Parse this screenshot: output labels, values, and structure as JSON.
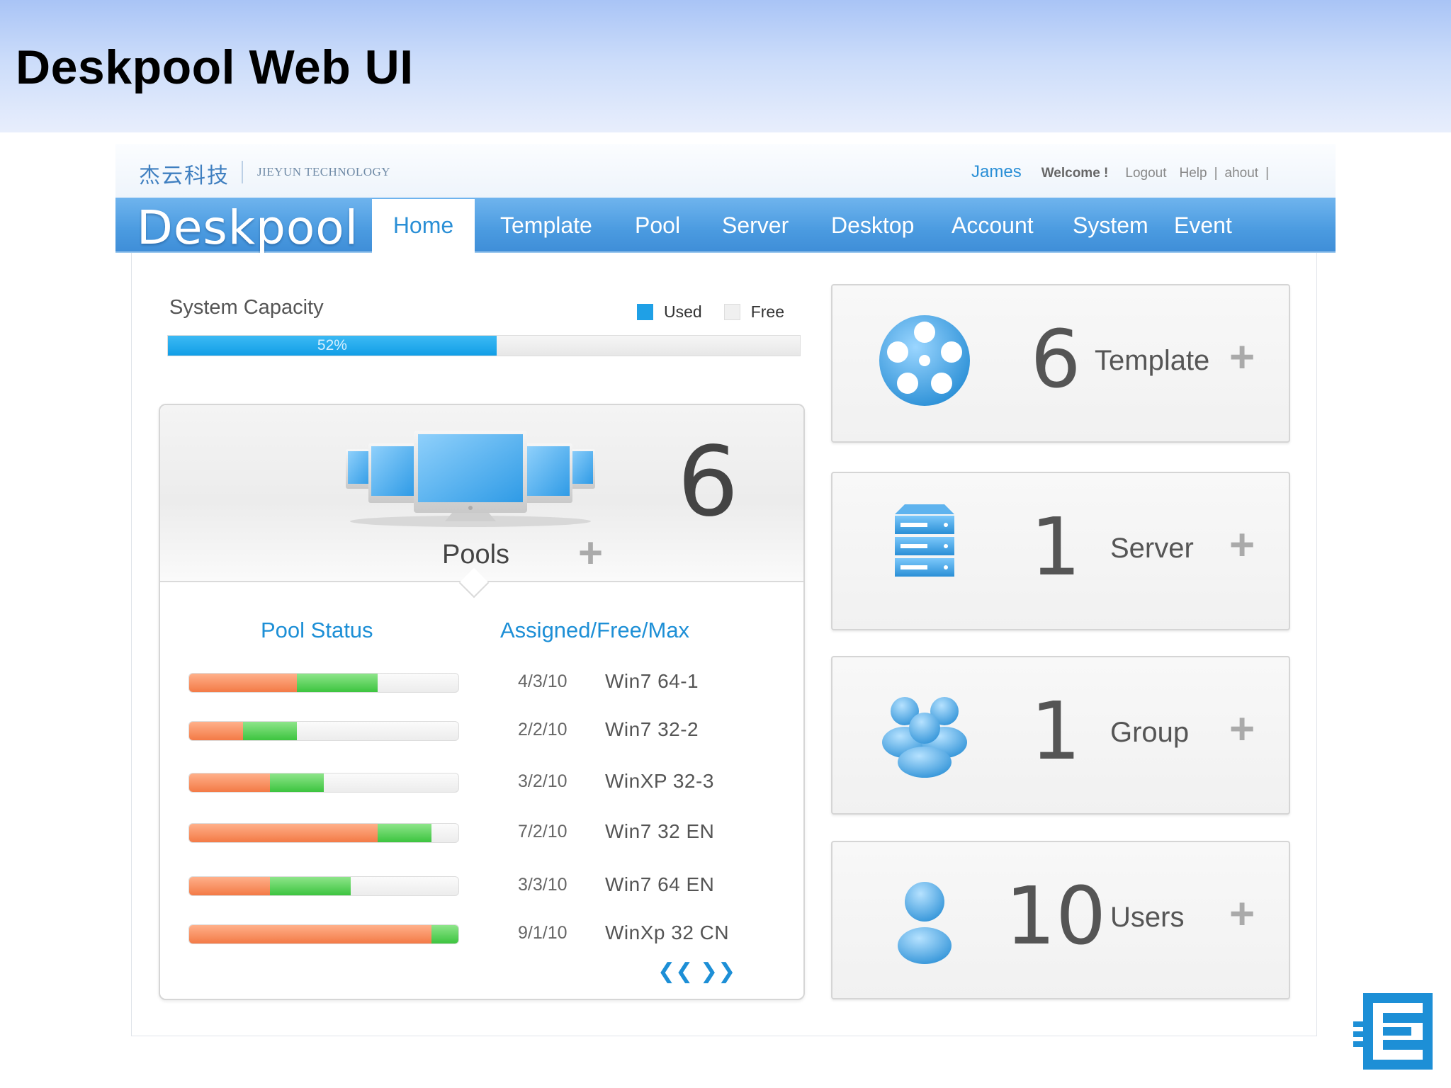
{
  "slide": {
    "title": "Deskpool Web UI"
  },
  "header": {
    "brand_cn": "杰云科技",
    "brand_en": "JIEYUN TECHNOLOGY",
    "user": "James",
    "welcome": "Welcome !",
    "links": [
      "Logout",
      "Help",
      "ahout"
    ]
  },
  "nav": {
    "logo": "Deskpool",
    "tabs": [
      "Home",
      "Template",
      "Pool",
      "Server",
      "Desktop",
      "Account",
      "System",
      "Event"
    ],
    "active": "Home"
  },
  "capacity": {
    "title": "System Capacity",
    "legend_used": "Used",
    "legend_free": "Free",
    "used_percent": 52,
    "label": "52%",
    "colors": {
      "used": "#1fa0e6",
      "free": "#f0f0f0"
    }
  },
  "pools": {
    "count": "6",
    "label": "Pools",
    "plus": "+",
    "col_status": "Pool Status",
    "col_afm": "Assigned/Free/Max",
    "rows": [
      {
        "afm": "4/3/10",
        "name": "Win7 64-1",
        "assigned": 4,
        "free": 3,
        "max": 10
      },
      {
        "afm": "2/2/10",
        "name": "Win7 32-2",
        "assigned": 2,
        "free": 2,
        "max": 10
      },
      {
        "afm": "3/2/10",
        "name": "WinXP 32-3",
        "assigned": 3,
        "free": 2,
        "max": 10
      },
      {
        "afm": "7/2/10",
        "name": "Win7 32 EN",
        "assigned": 7,
        "free": 2,
        "max": 10
      },
      {
        "afm": "3/3/10",
        "name": "Win7 64 EN",
        "assigned": 3,
        "free": 3,
        "max": 10
      },
      {
        "afm": "9/1/10",
        "name": "WinXp 32 CN",
        "assigned": 9,
        "free": 1,
        "max": 10
      }
    ],
    "prev": "❮❮",
    "next": "❯❯",
    "colors": {
      "assigned": "#f37a46",
      "free": "#3cc43f"
    }
  },
  "cards": [
    {
      "count": "6",
      "label": "Template",
      "plus": "+",
      "icon": "film-reel-icon"
    },
    {
      "count": "1",
      "label": "Server",
      "plus": "+",
      "icon": "server-rack-icon"
    },
    {
      "count": "1",
      "label": "Group",
      "plus": "+",
      "icon": "user-group-icon"
    },
    {
      "count": "10",
      "label": "Users",
      "plus": "+",
      "icon": "user-icon"
    }
  ],
  "accent": "#2a8fd6"
}
